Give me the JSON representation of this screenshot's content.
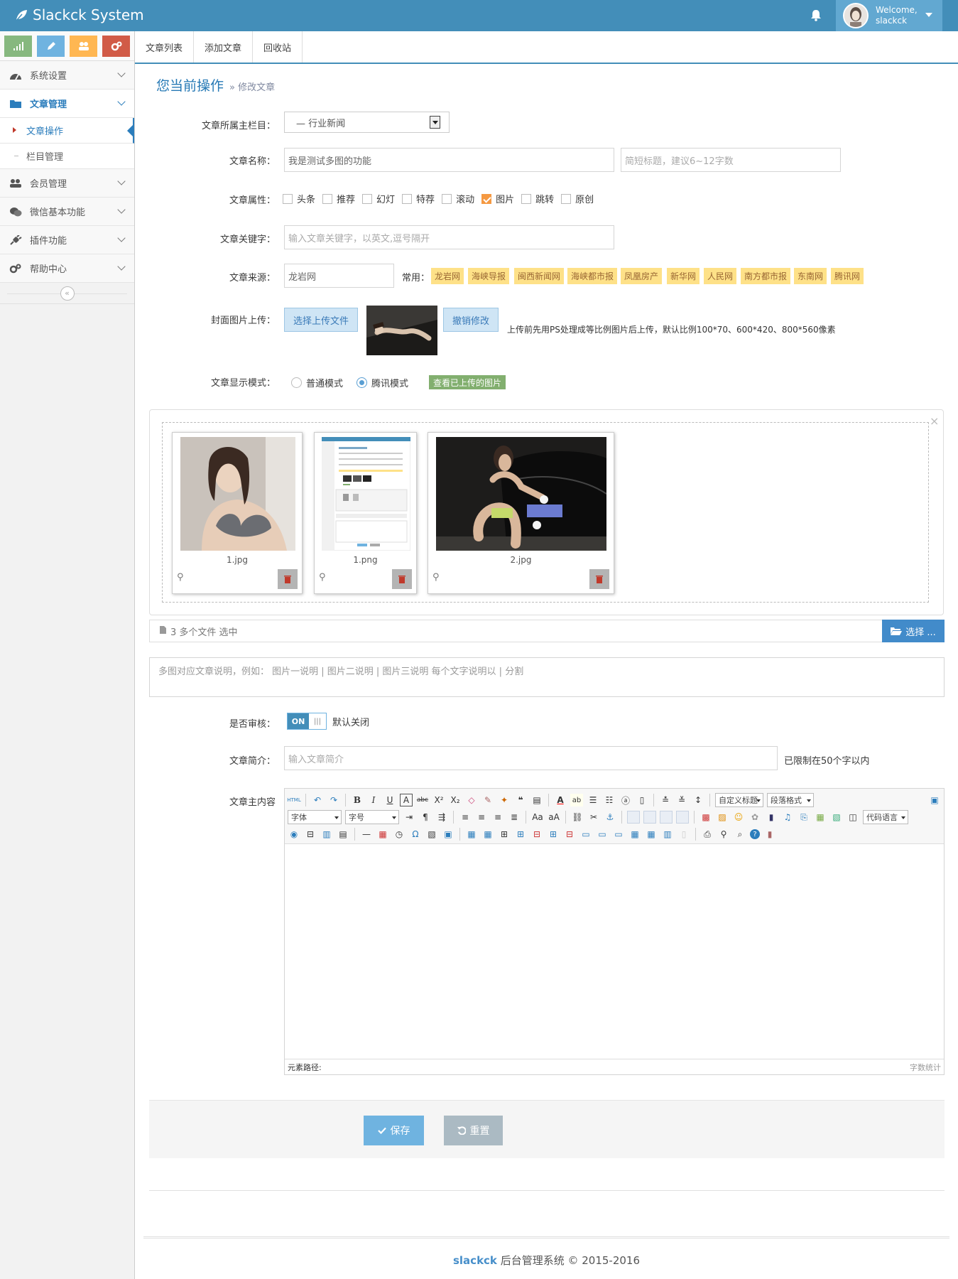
{
  "header": {
    "brand": "Slackck System",
    "welcome": "Welcome,",
    "username": "slackck"
  },
  "sidebar": {
    "items": [
      {
        "label": "系统设置"
      },
      {
        "label": "文章管理",
        "children": [
          {
            "label": "文章操作"
          },
          {
            "label": "栏目管理"
          }
        ]
      },
      {
        "label": "会员管理"
      },
      {
        "label": "微信基本功能"
      },
      {
        "label": "插件功能"
      },
      {
        "label": "帮助中心"
      }
    ]
  },
  "tabs": [
    {
      "label": "文章列表"
    },
    {
      "label": "添加文章"
    },
    {
      "label": "回收站"
    }
  ],
  "breadcrumb": {
    "title": "您当前操作",
    "sub": "» 修改文章"
  },
  "form": {
    "category": {
      "label": "文章所属主栏目：",
      "value": "— 行业新闻"
    },
    "title": {
      "label": "文章名称：",
      "value": "我是测试多图的功能",
      "short_placeholder": "简短标题，建议6~12字数"
    },
    "attrs": {
      "label": "文章属性：",
      "options": [
        {
          "label": "头条",
          "checked": false
        },
        {
          "label": "推荐",
          "checked": false
        },
        {
          "label": "幻灯",
          "checked": false
        },
        {
          "label": "特荐",
          "checked": false
        },
        {
          "label": "滚动",
          "checked": false
        },
        {
          "label": "图片",
          "checked": true
        },
        {
          "label": "跳转",
          "checked": false
        },
        {
          "label": "原创",
          "checked": false
        }
      ]
    },
    "keywords": {
      "label": "文章关键字：",
      "placeholder": "输入文章关键字，以英文,逗号隔开"
    },
    "source": {
      "label": "文章来源：",
      "value": "龙岩网",
      "common_label": "常用：",
      "tags": [
        "龙岩网",
        "海峡导报",
        "闽西新闻网",
        "海峡都市报",
        "凤凰房产",
        "新华网",
        "人民网",
        "南方都市报",
        "东南网",
        "腾讯网"
      ]
    },
    "cover": {
      "label": "封面图片上传：",
      "upload_btn": "选择上传文件",
      "revert_btn": "撤销修改",
      "hint": "上传前先用PS处理成等比例图片后上传，默认比例100*70、600*420、800*560像素"
    },
    "display": {
      "label": "文章显示模式：",
      "normal": "普通模式",
      "tencent": "腾讯模式",
      "selected": "tencent",
      "view_btn": "查看已上传的图片"
    },
    "uploads": {
      "files": [
        {
          "name": "1.jpg"
        },
        {
          "name": "1.png"
        },
        {
          "name": "2.jpg"
        }
      ],
      "status": "3 多个文件 选中",
      "choose_btn": "选择 ..."
    },
    "multi_desc_placeholder": "多图对应文章说明，例如：  图片一说明 | 图片二说明 | 图片三说明    每个文字说明以 | 分割",
    "review": {
      "label": "是否审核：",
      "on": "ON",
      "off": "|||",
      "note": "默认关闭"
    },
    "summary": {
      "label": "文章简介：",
      "placeholder": "输入文章简介",
      "note": "已限制在50个字以内"
    },
    "content": {
      "label": "文章主内容"
    }
  },
  "editor": {
    "custom_title": "自定义标题",
    "para_format": "段落格式",
    "font": "字体",
    "size": "字号",
    "code_lang": "代码语言",
    "path_label": "元素路径:",
    "word_count": "字数统计"
  },
  "actions": {
    "save": "保存",
    "reset": "重置"
  },
  "footer": {
    "brand": "slackck",
    "text": "后台管理系统 © 2015-2016"
  },
  "colors": {
    "primary": "#438eb9",
    "accent": "#f59942",
    "tag": "#fee188",
    "success": "#82af6f"
  }
}
